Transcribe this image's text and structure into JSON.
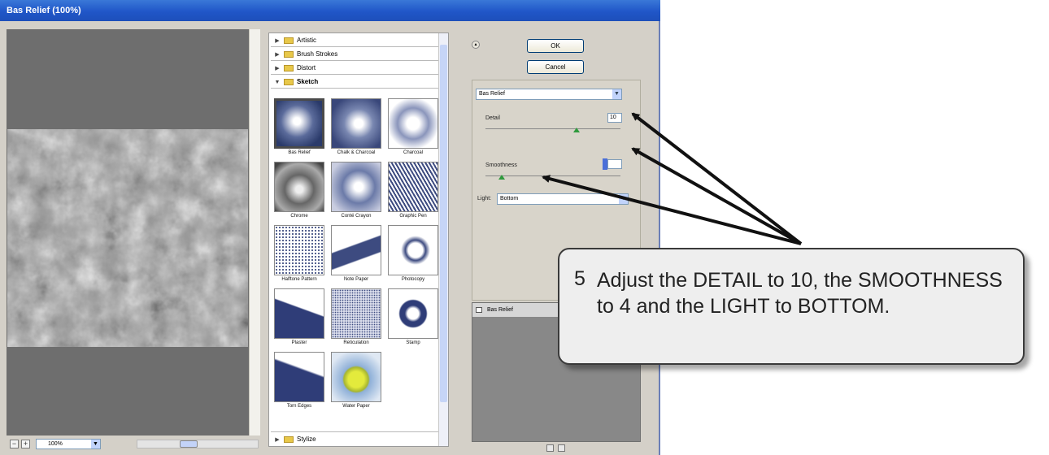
{
  "window": {
    "title": "Bas Relief (100%)"
  },
  "preview": {
    "zoom": "100%"
  },
  "gallery": {
    "categories_top": [
      "Artistic",
      "Brush Strokes",
      "Distort"
    ],
    "open_category": "Sketch",
    "filters": [
      {
        "label": "Bas Relief"
      },
      {
        "label": "Chalk & Charcoal"
      },
      {
        "label": "Charcoal"
      },
      {
        "label": "Chrome"
      },
      {
        "label": "Conté Crayon"
      },
      {
        "label": "Graphic Pen"
      },
      {
        "label": "Halftone Pattern"
      },
      {
        "label": "Note Paper"
      },
      {
        "label": "Photocopy"
      },
      {
        "label": "Plaster"
      },
      {
        "label": "Reticulation"
      },
      {
        "label": "Stamp"
      },
      {
        "label": "Torn Edges"
      },
      {
        "label": "Water Paper"
      }
    ],
    "categories_bottom": [
      "Stylize"
    ]
  },
  "buttons": {
    "ok": "OK",
    "cancel": "Cancel"
  },
  "settings": {
    "filter_select": "Bas Relief",
    "detail_label": "Detail",
    "detail_value": "10",
    "smoothness_label": "Smoothness",
    "smoothness_value": "4",
    "light_label": "Light:",
    "light_value": "Bottom"
  },
  "layers": {
    "row": "Bas Relief"
  },
  "callout": {
    "number": "5",
    "text": "Adjust the DETAIL to 10, the SMOOTHNESS to 4 and the LIGHT to BOTTOM."
  }
}
